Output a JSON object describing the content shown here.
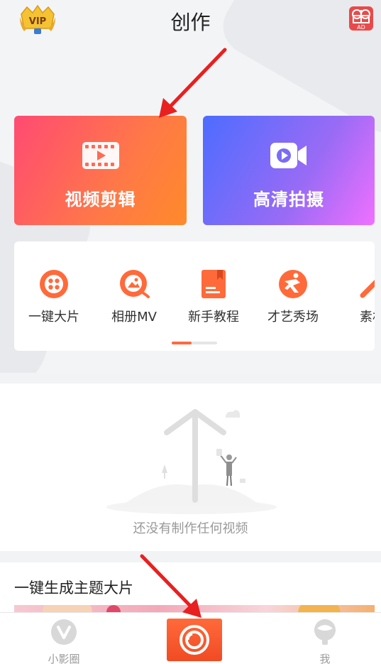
{
  "header": {
    "title": "创作",
    "vip_badge_text": "VIP",
    "ad_icon_text": "AD",
    "vip_icon": "vip-crown-icon",
    "ad_icon": "ad-gift-icon"
  },
  "cards": [
    {
      "label": "视频剪辑",
      "icon": "film-clip-icon",
      "colors": [
        "#ff4a73",
        "#ff8a2a"
      ]
    },
    {
      "label": "高清拍摄",
      "icon": "video-camera-icon",
      "colors": [
        "#4d6cff",
        "#f070ff"
      ]
    }
  ],
  "tools": [
    {
      "label": "一键大片",
      "icon": "one-click-icon"
    },
    {
      "label": "相册MV",
      "icon": "album-mv-icon"
    },
    {
      "label": "新手教程",
      "icon": "tutorial-book-icon"
    },
    {
      "label": "才艺秀场",
      "icon": "dance-show-icon"
    },
    {
      "label": "素材",
      "icon": "magic-wand-icon"
    }
  ],
  "empty_state": {
    "text": "还没有制作任何视频"
  },
  "themes": {
    "title": "一键生成主题大片"
  },
  "bottom_nav": {
    "left_label": "小影圈",
    "right_label": "我",
    "accent": "#f14b24"
  }
}
